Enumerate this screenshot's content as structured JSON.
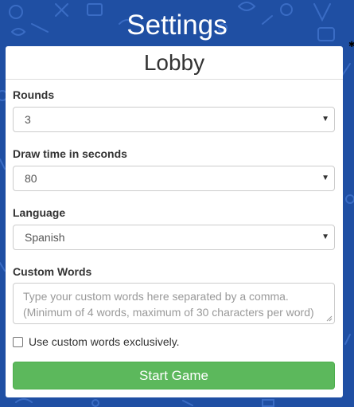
{
  "page": {
    "title": "Settings"
  },
  "panel": {
    "title": "Lobby"
  },
  "form": {
    "rounds": {
      "label": "Rounds",
      "value": "3"
    },
    "draw_time": {
      "label": "Draw time in seconds",
      "value": "80"
    },
    "language": {
      "label": "Language",
      "value": "Spanish"
    },
    "custom_words": {
      "label": "Custom Words",
      "placeholder_line1": "Type your custom words here separated by a comma.",
      "placeholder_line2": "(Minimum of 4 words, maximum of 30 characters per word)"
    },
    "exclusive": {
      "label": "Use custom words exclusively.",
      "checked": false
    },
    "start_label": "Start Game"
  },
  "colors": {
    "background": "#1f4fa3",
    "button": "#5cb85c",
    "panel": "#ffffff"
  },
  "icons": {
    "select_arrow": "▼",
    "edge_glyph": "✱"
  }
}
